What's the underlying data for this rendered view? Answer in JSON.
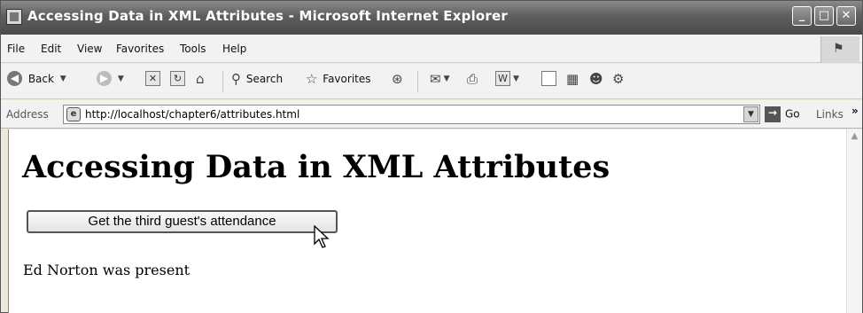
{
  "window": {
    "title": "Accessing Data in XML Attributes - Microsoft Internet Explorer",
    "controls": {
      "minimize": "_",
      "maximize": "□",
      "close": "✕"
    }
  },
  "menubar": {
    "items": [
      "File",
      "Edit",
      "View",
      "Favorites",
      "Tools",
      "Help"
    ]
  },
  "toolbar": {
    "back_label": "Back",
    "search_label": "Search",
    "favorites_label": "Favorites",
    "icons": [
      "back-icon",
      "forward-icon",
      "stop-icon",
      "refresh-icon",
      "home-icon",
      "search-icon",
      "favorites-star-icon",
      "media-icon",
      "mail-icon",
      "print-icon",
      "edit-word-icon",
      "discuss-icon",
      "research-icon",
      "messenger-icon",
      "tools-icon"
    ]
  },
  "addressbar": {
    "label": "Address",
    "url": "http://localhost/chapter6/attributes.html",
    "go_label": "Go",
    "links_label": "Links"
  },
  "page": {
    "heading": "Accessing Data in XML Attributes",
    "button_label": "Get the third guest's attendance",
    "result": "Ed Norton was present"
  }
}
